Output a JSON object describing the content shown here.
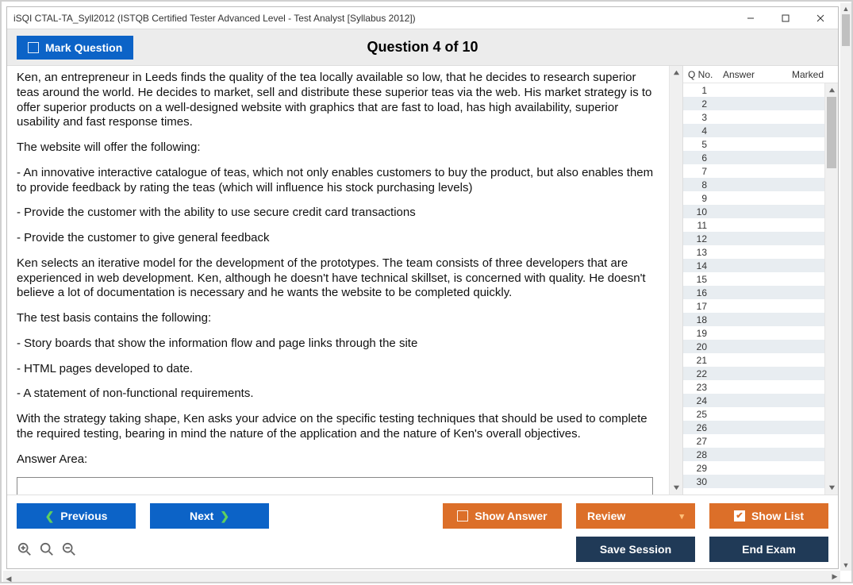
{
  "window": {
    "title": "iSQI CTAL-TA_Syll2012 (ISTQB Certified Tester Advanced Level - Test Analyst [Syllabus 2012])"
  },
  "header": {
    "mark_question": "Mark Question",
    "question_title": "Question 4 of 10"
  },
  "question": {
    "paragraphs": [
      "Ken, an entrepreneur in Leeds finds the quality of the tea locally available so low, that he decides to research superior teas around the world. He decides to market, sell and distribute these superior teas via the web. His market strategy is to offer superior products on a well-designed website with graphics that are fast to load, has high availability, superior usability and fast response times.",
      "The website will offer the following:",
      "- An innovative interactive catalogue of teas, which not only enables customers to buy the product, but also enables them to provide feedback by rating the teas (which will influence his stock purchasing levels)",
      "- Provide the customer with the ability to use secure credit card transactions",
      "- Provide the customer to give general feedback",
      "Ken selects an iterative model for the development of the prototypes. The team consists of three developers that are experienced in web development. Ken, although he doesn't have technical skillset, is concerned with quality. He doesn't believe a lot of documentation is necessary and he wants the website to be completed quickly.",
      "The test basis contains the following:",
      "- Story boards that show the information flow and page links through the site",
      "- HTML pages developed to date.",
      "- A statement of non-functional requirements.",
      "With the strategy taking shape, Ken asks your advice on the specific testing techniques that should be used to complete the required testing, bearing in mind the nature of the application and the nature of Ken's overall objectives."
    ],
    "answer_area_label": "Answer Area:",
    "answer_value": ""
  },
  "side": {
    "headers": {
      "q": "Q No.",
      "a": "Answer",
      "m": "Marked"
    },
    "rows": [
      1,
      2,
      3,
      4,
      5,
      6,
      7,
      8,
      9,
      10,
      11,
      12,
      13,
      14,
      15,
      16,
      17,
      18,
      19,
      20,
      21,
      22,
      23,
      24,
      25,
      26,
      27,
      28,
      29,
      30
    ]
  },
  "footer": {
    "previous": "Previous",
    "next": "Next",
    "show_answer": "Show Answer",
    "review": "Review",
    "show_list": "Show List",
    "save_session": "Save Session",
    "end_exam": "End Exam"
  }
}
